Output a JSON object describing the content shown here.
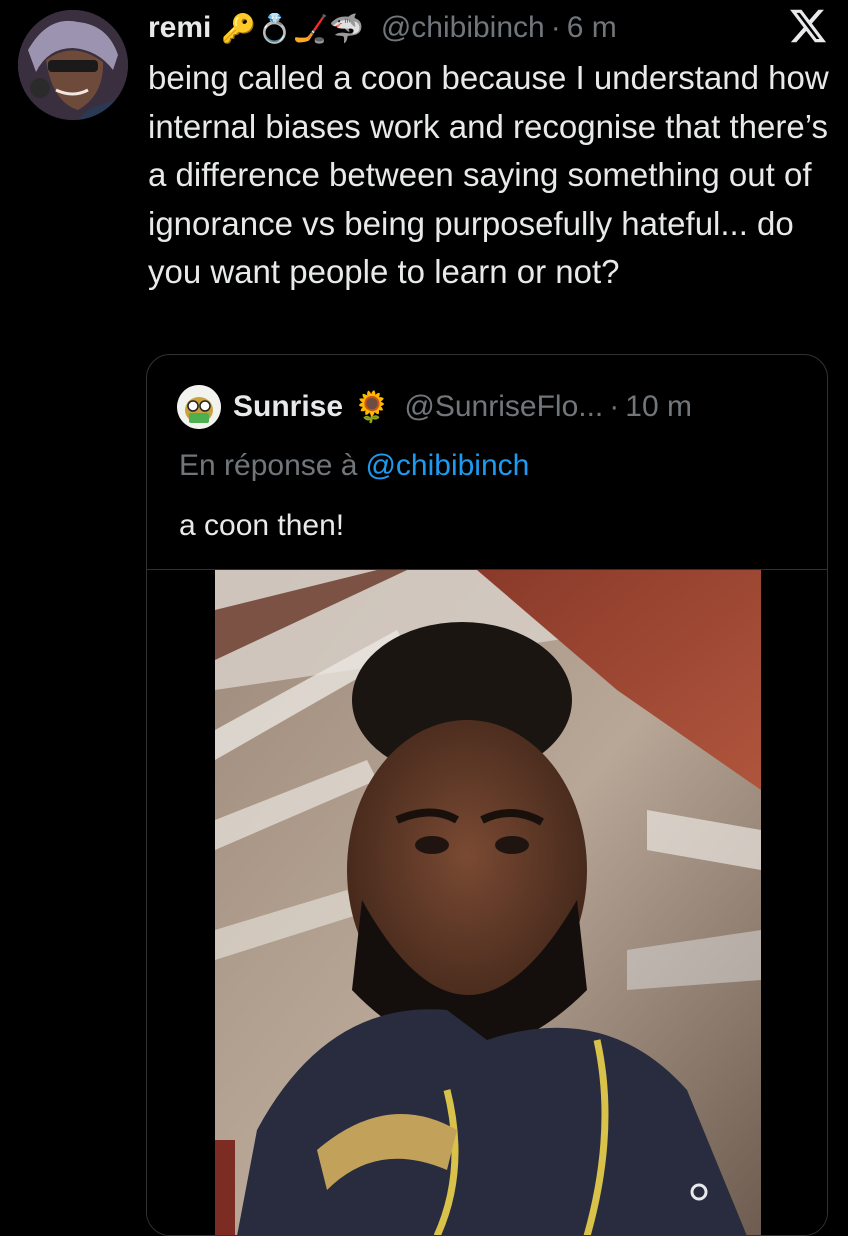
{
  "tweet": {
    "display_name": "remi",
    "emojis": "🔑💍🏒🦈",
    "handle": "@chibibinch",
    "separator": "·",
    "time": "6 m",
    "text": "being called a coon because I understand how internal biases work and recognise that there’s a difference between saying something out of ignorance vs being purposefully hateful... do you want people to learn or not?"
  },
  "quote": {
    "display_name": "Sunrise",
    "emoji": "🌻",
    "handle": "@SunriseFlo...",
    "separator": "·",
    "time": "10 m",
    "reply_prefix": "En réponse à",
    "reply_mention": "@chibibinch",
    "text": "a coon then!"
  },
  "icons": {
    "platform": "x-logo-icon",
    "media": "video-thumbnail"
  },
  "colors": {
    "background": "#000000",
    "text_primary": "#e7e9ea",
    "text_secondary": "#71767b",
    "link": "#1d9bf0",
    "border": "#2f3336"
  }
}
